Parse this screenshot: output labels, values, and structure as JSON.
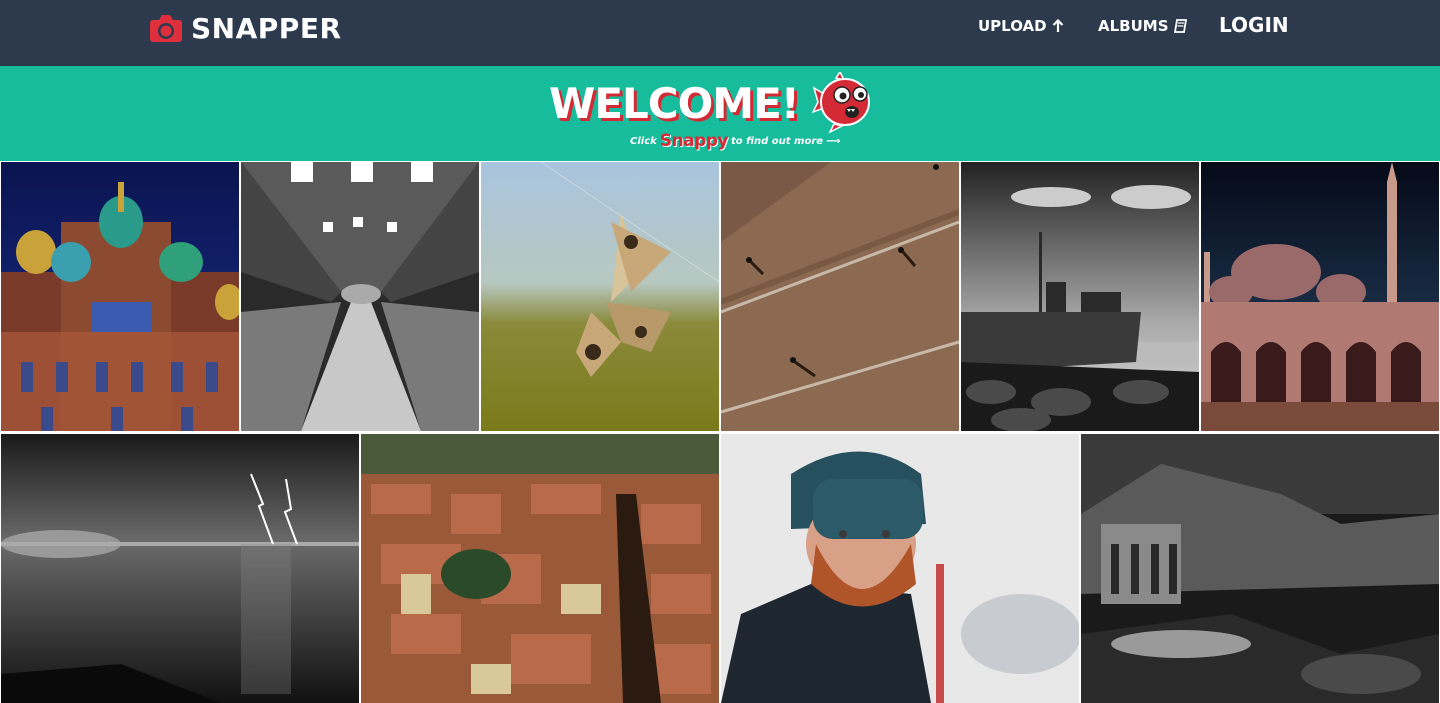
{
  "navbar": {
    "brand": "SNAPPER",
    "brand_icon": "camera-icon",
    "links": {
      "upload": "UPLOAD",
      "albums": "ALBUMS",
      "login": "LOGIN"
    },
    "colors": {
      "background": "#2d3a4e",
      "brand_icon": "#e02f3c"
    }
  },
  "banner": {
    "title": "WELCOME!",
    "tagline_before": "Click",
    "tagline_link": "Snappy",
    "tagline_after": "to find out more",
    "arrow": "⟶",
    "mascot": "red-fish-mascot-icon",
    "colors": {
      "background": "#17bc9c",
      "accent": "#d42a36"
    }
  },
  "gallery": {
    "photos": [
      {
        "subject": "onion-dome-cathedral"
      },
      {
        "subject": "tunnel-walkway"
      },
      {
        "subject": "butterfly"
      },
      {
        "subject": "aerial-people-shadows"
      },
      {
        "subject": "shipwreck"
      },
      {
        "subject": "mosque"
      },
      {
        "subject": "lightning-over-sea"
      },
      {
        "subject": "city-rooftops"
      },
      {
        "subject": "bearded-man-beanie"
      },
      {
        "subject": "desert-temple"
      }
    ]
  }
}
